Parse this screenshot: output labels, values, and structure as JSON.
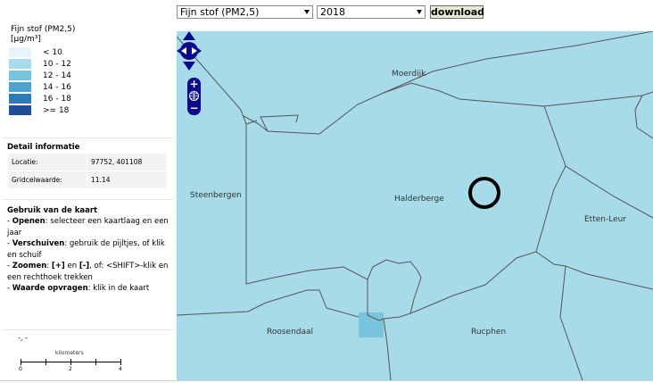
{
  "toolbar": {
    "layer_select": "Fijn stof (PM2,5)",
    "year_select": "2018",
    "download_label": "download"
  },
  "legend": {
    "title_line1": "Fijn stof (PM2,5)",
    "title_line2": "[µg/m³]",
    "classes": [
      {
        "label": "< 10",
        "color": "#e7f4f9"
      },
      {
        "label": "10 - 12",
        "color": "#a7dbe9"
      },
      {
        "label": "12 - 14",
        "color": "#78c4dd"
      },
      {
        "label": "14 - 16",
        "color": "#4da3cc"
      },
      {
        "label": "16 - 18",
        "color": "#2f79b6"
      },
      {
        "label": ">= 18",
        "color": "#1f4e96"
      }
    ]
  },
  "detail": {
    "heading": "Detail informatie",
    "rows": [
      {
        "key": "Locatie:",
        "value": "97752, 401108"
      },
      {
        "key": "Gridcelwaarde:",
        "value": "11.14"
      }
    ]
  },
  "usage": {
    "heading": "Gebruik van de kaart",
    "items": [
      {
        "bold": "Openen",
        "text": ": selecteer een kaartlaag en een jaar"
      },
      {
        "bold": "Verschuiven",
        "text": ": gebruik de pijltjes, of klik en schuif"
      },
      {
        "bold": "Zoomen",
        "mid_bold_1": "[+]",
        "mid_text": " en ",
        "mid_bold_2": "[-]",
        "text": ", of: <SHIFT>-klik en een rechthoek trekken"
      },
      {
        "bold": "Waarde opvragen",
        "text": ": klik in de kaart"
      }
    ]
  },
  "coordinates": "-, -",
  "scale": {
    "unit": "kilometers",
    "ticks": [
      "0",
      "2",
      "4"
    ]
  },
  "map": {
    "places": [
      "Moerdijk",
      "Steenbergen",
      "Halderberge",
      "Etten-Leur",
      "Roosendaal",
      "Rucphen"
    ],
    "base_color": "#a7dbe9",
    "selected_cell_color": "#78c4dd",
    "zoom_in": "+",
    "zoom_out": "−"
  }
}
